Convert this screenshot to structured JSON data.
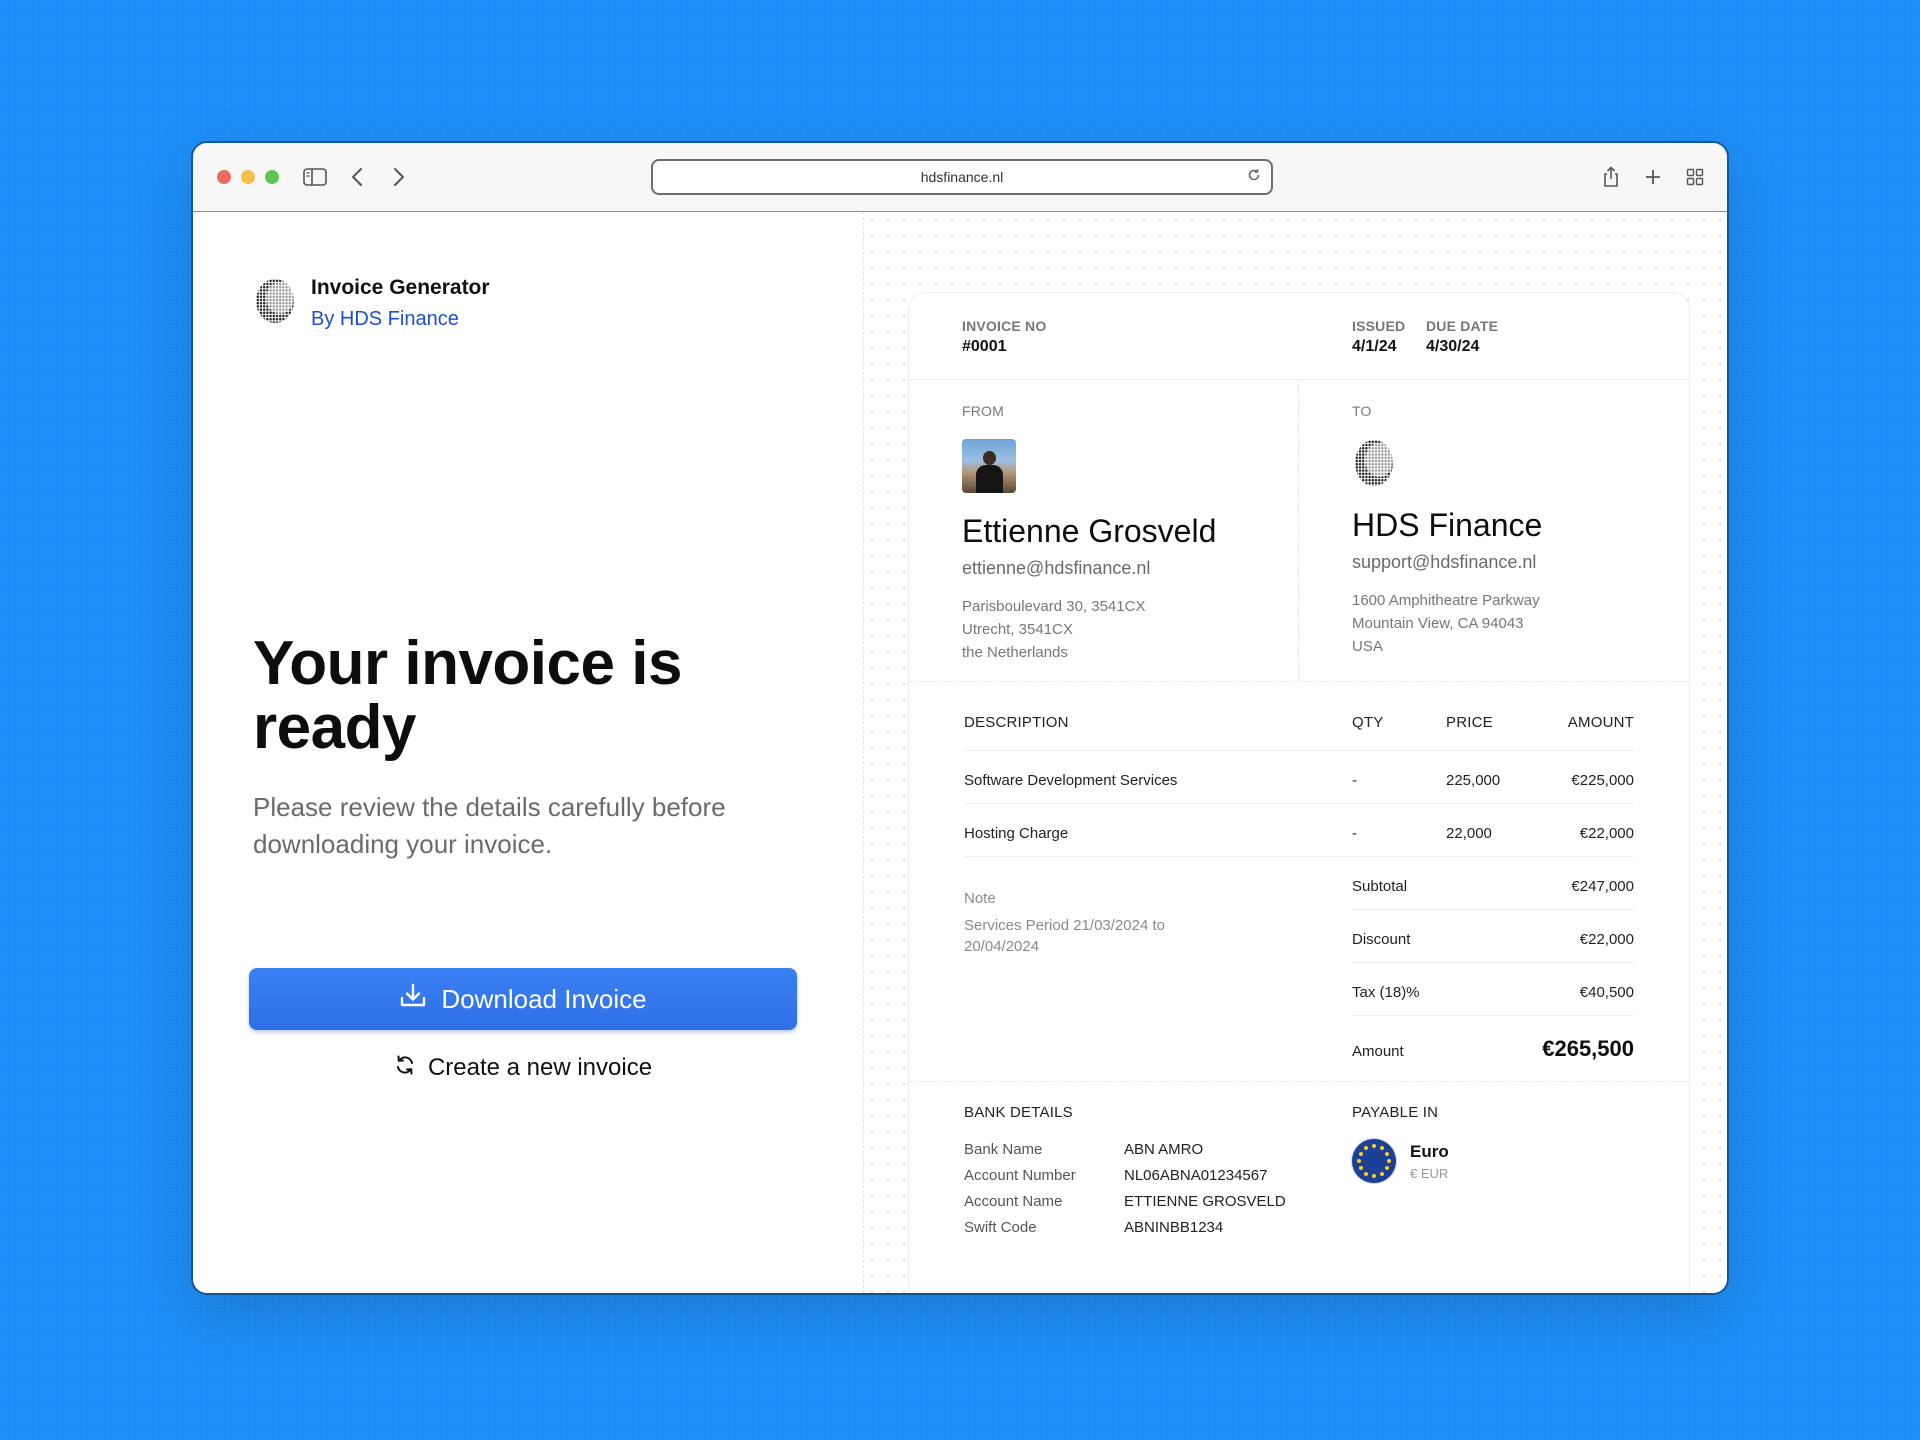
{
  "browser": {
    "url": "hdsfinance.nl"
  },
  "brand": {
    "title": "Invoice Generator",
    "subtitle": "By HDS Finance"
  },
  "hero": {
    "headline": "Your invoice is ready",
    "lead": "Please review the details carefully before downloading your invoice.",
    "download_label": "Download Invoice",
    "new_label": "Create a new invoice"
  },
  "invoice": {
    "number_label": "INVOICE NO",
    "number": "#0001",
    "issued_label": "ISSUED",
    "issued": "4/1/24",
    "due_label": "DUE DATE",
    "due": "4/30/24",
    "from": {
      "label": "FROM",
      "name": "Ettienne Grosveld",
      "email": "ettienne@hdsfinance.nl",
      "address": [
        "Parisboulevard 30, 3541CX",
        "Utrecht, 3541CX",
        "the Netherlands"
      ]
    },
    "to": {
      "label": "TO",
      "name": "HDS Finance",
      "email": "support@hdsfinance.nl",
      "address": [
        "1600 Amphitheatre Parkway",
        "Mountain View, CA 94043",
        "USA"
      ]
    },
    "table": {
      "headers": {
        "description": "DESCRIPTION",
        "qty": "QTY",
        "price": "PRICE",
        "amount": "AMOUNT"
      },
      "items": [
        {
          "description": "Software Development Services",
          "qty": "-",
          "price": "225,000",
          "amount": "€225,000"
        },
        {
          "description": "Hosting Charge",
          "qty": "-",
          "price": "22,000",
          "amount": "€22,000"
        }
      ]
    },
    "note": {
      "label": "Note",
      "text": "Services Period 21/03/2024 to 20/04/2024"
    },
    "totals": {
      "subtotal_label": "Subtotal",
      "subtotal": "€247,000",
      "discount_label": "Discount",
      "discount": "€22,000",
      "tax_label": "Tax (18)%",
      "tax": "€40,500",
      "amount_label": "Amount",
      "amount": "€265,500"
    },
    "bank": {
      "label": "BANK DETAILS",
      "rows": [
        {
          "k": "Bank Name",
          "v": "ABN AMRO"
        },
        {
          "k": "Account Number",
          "v": "NL06ABNA01234567"
        },
        {
          "k": "Account Name",
          "v": "ETTIENNE GROSVELD"
        },
        {
          "k": "Swift Code",
          "v": "ABNINBB1234"
        }
      ]
    },
    "payable": {
      "label": "PAYABLE IN",
      "currency": "Euro",
      "code": "€ EUR"
    }
  },
  "icons": {
    "sidebar": "sidebar-icon",
    "back": "chevron-left-icon",
    "forward": "chevron-right-icon",
    "reload": "reload-icon",
    "share": "share-icon",
    "new_tab": "plus-icon",
    "tabs": "grid-icon",
    "download": "download-icon",
    "refresh": "refresh-icon",
    "logo": "halftone-sphere-icon",
    "flag": "eu-flag-icon"
  },
  "colors": {
    "background": "#1a8cf7",
    "accent": "#3a80f2",
    "link": "#1d4ed8"
  }
}
